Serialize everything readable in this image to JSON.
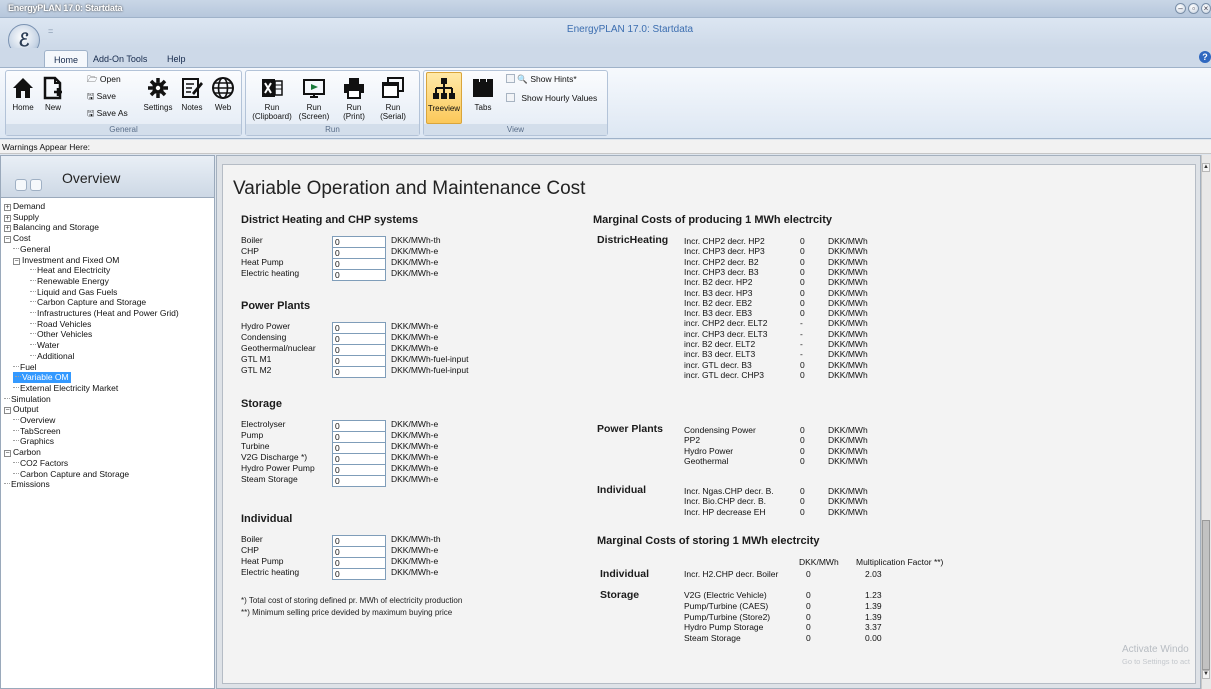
{
  "window": {
    "app_title": "EnergyPLAN 17.0: Startdata",
    "title": "EnergyPLAN 17.0: Startdata",
    "qat_arrow": "=",
    "controls": {
      "minimize": "–",
      "restore": "▫",
      "close": "×"
    }
  },
  "ribbon": {
    "tabs": [
      "Home",
      "Add-On Tools",
      "Help"
    ],
    "general": {
      "caption": "General",
      "home": "Home",
      "new": "New",
      "open": "Open",
      "save": "Save",
      "save_as": "Save As",
      "settings": "Settings",
      "notes": "Notes",
      "web": "Web"
    },
    "run": {
      "caption": "Run",
      "clipboard": [
        "Run",
        "(Clipboard)"
      ],
      "screen": [
        "Run",
        "(Screen)"
      ],
      "print": [
        "Run",
        "(Print)"
      ],
      "serial": [
        "Run",
        "(Serial)"
      ]
    },
    "view": {
      "caption": "View",
      "treeview": "Treeview",
      "tabs": "Tabs",
      "show_hints": "Show Hints*",
      "show_hourly": "Show Hourly Values"
    }
  },
  "warnings": "Warnings Appear Here:",
  "overview": {
    "title": "Overview",
    "tree": [
      {
        "label": "Demand",
        "level": 0,
        "exp": "+"
      },
      {
        "label": "Supply",
        "level": 0,
        "exp": "+"
      },
      {
        "label": "Balancing and Storage",
        "level": 0,
        "exp": "+"
      },
      {
        "label": "Cost",
        "level": 0,
        "exp": "-"
      },
      {
        "label": "General",
        "level": 1
      },
      {
        "label": "Investment and Fixed OM",
        "level": 1,
        "exp": "-"
      },
      {
        "label": "Heat and Electricity",
        "level": 2
      },
      {
        "label": "Renewable Energy",
        "level": 2
      },
      {
        "label": "Liquid and Gas Fuels",
        "level": 2
      },
      {
        "label": "Carbon Capture and Storage",
        "level": 2
      },
      {
        "label": "Infrastructures (Heat and Power Grid)",
        "level": 2
      },
      {
        "label": "Road Vehicles",
        "level": 2
      },
      {
        "label": "Other Vehicles",
        "level": 2
      },
      {
        "label": "Water",
        "level": 2
      },
      {
        "label": "Additional",
        "level": 2
      },
      {
        "label": "Fuel",
        "level": 1
      },
      {
        "label": "Variable OM",
        "level": 1,
        "selected": true
      },
      {
        "label": "External Electricity Market",
        "level": 1
      },
      {
        "label": "Simulation",
        "level": 0
      },
      {
        "label": "Output",
        "level": 0,
        "exp": "-"
      },
      {
        "label": "Overview",
        "level": 1
      },
      {
        "label": "TabScreen",
        "level": 1
      },
      {
        "label": "Graphics",
        "level": 1
      },
      {
        "label": "Carbon",
        "level": 0,
        "exp": "-"
      },
      {
        "label": "CO2 Factors",
        "level": 1
      },
      {
        "label": "Carbon Capture and Storage",
        "level": 1
      },
      {
        "label": "Emissions",
        "level": 0
      }
    ]
  },
  "main": {
    "title": "Variable Operation and Maintenance Cost",
    "dh": {
      "heading": "District Heating and CHP systems",
      "rows": [
        {
          "label": "Boiler",
          "value": "0",
          "unit": "DKK/MWh-th"
        },
        {
          "label": "CHP",
          "value": "0",
          "unit": "DKK/MWh-e"
        },
        {
          "label": "Heat Pump",
          "value": "0",
          "unit": "DKK/MWh-e"
        },
        {
          "label": "Electric heating",
          "value": "0",
          "unit": "DKK/MWh-e"
        }
      ]
    },
    "pp": {
      "heading": "Power Plants",
      "rows": [
        {
          "label": "Hydro Power",
          "value": "0",
          "unit": "DKK/MWh-e"
        },
        {
          "label": "Condensing",
          "value": "0",
          "unit": "DKK/MWh-e"
        },
        {
          "label": "Geothermal/nuclear",
          "value": "0",
          "unit": "DKK/MWh-e"
        },
        {
          "label": "GTL M1",
          "value": "0",
          "unit": "DKK/MWh-fuel-input"
        },
        {
          "label": "GTL M2",
          "value": "0",
          "unit": "DKK/MWh-fuel-input"
        }
      ]
    },
    "st": {
      "heading": "Storage",
      "rows": [
        {
          "label": "Electrolyser",
          "value": "0",
          "unit": "DKK/MWh-e"
        },
        {
          "label": "Pump",
          "value": "0",
          "unit": "DKK/MWh-e"
        },
        {
          "label": "Turbine",
          "value": "0",
          "unit": "DKK/MWh-e"
        },
        {
          "label": "V2G Discharge *)",
          "value": "0",
          "unit": "DKK/MWh-e"
        },
        {
          "label": "Hydro Power Pump",
          "value": "0",
          "unit": "DKK/MWh-e"
        },
        {
          "label": "Steam Storage",
          "value": "0",
          "unit": "DKK/MWh-e"
        }
      ]
    },
    "ind": {
      "heading": "Individual",
      "rows": [
        {
          "label": "Boiler",
          "value": "0",
          "unit": "DKK/MWh-th"
        },
        {
          "label": "CHP",
          "value": "0",
          "unit": "DKK/MWh-e"
        },
        {
          "label": "Heat Pump",
          "value": "0",
          "unit": "DKK/MWh-e"
        },
        {
          "label": "Electric heating",
          "value": "0",
          "unit": "DKK/MWh-e"
        }
      ]
    },
    "notes": [
      "*) Total cost of storing defined pr. MWh of electricity production",
      "**) Minimum selling price devided by maximum buying price"
    ],
    "marginal_produce": {
      "heading": "Marginal Costs of producing 1 MWh electrcity",
      "sections": [
        {
          "title": "DistricHeating",
          "rows": [
            [
              "Incr. CHP2 decr. HP2",
              "0",
              "DKK/MWh"
            ],
            [
              "Incr. CHP3 decr. HP3",
              "0",
              "DKK/MWh"
            ],
            [
              "Incr. CHP2 decr. B2",
              "0",
              "DKK/MWh"
            ],
            [
              "Incr. CHP3 decr. B3",
              "0",
              "DKK/MWh"
            ],
            [
              "Incr. B2 decr. HP2",
              "0",
              "DKK/MWh"
            ],
            [
              "Incr. B3 decr. HP3",
              "0",
              "DKK/MWh"
            ],
            [
              "Incr. B2 decr. EB2",
              "0",
              "DKK/MWh"
            ],
            [
              "Incr. B3 decr. EB3",
              "0",
              "DKK/MWh"
            ],
            [
              "incr. CHP2 decr. ELT2",
              "-",
              "DKK/MWh"
            ],
            [
              "incr. CHP3 decr. ELT3",
              "-",
              "DKK/MWh"
            ],
            [
              "incr. B2 decr. ELT2",
              "-",
              "DKK/MWh"
            ],
            [
              "incr. B3 decr. ELT3",
              "-",
              "DKK/MWh"
            ],
            [
              "incr. GTL decr. B3",
              "0",
              "DKK/MWh"
            ],
            [
              "incr. GTL decr. CHP3",
              "0",
              "DKK/MWh"
            ]
          ]
        },
        {
          "title": "Power Plants",
          "rows": [
            [
              "Condensing Power",
              "0",
              "DKK/MWh"
            ],
            [
              "PP2",
              "0",
              "DKK/MWh"
            ],
            [
              "Hydro Power",
              "0",
              "DKK/MWh"
            ],
            [
              "Geothermal",
              "0",
              "DKK/MWh"
            ]
          ]
        },
        {
          "title": "Individual",
          "rows": [
            [
              "Incr. Ngas.CHP decr. B.",
              "0",
              "DKK/MWh"
            ],
            [
              "Incr. Bio.CHP decr. B.",
              "0",
              "DKK/MWh"
            ],
            [
              "Incr. HP decrease EH",
              "0",
              "DKK/MWh"
            ]
          ]
        }
      ]
    },
    "marginal_store": {
      "heading": "Marginal Costs of storing 1 MWh electrcity",
      "col1": "DKK/MWh",
      "col2": "Multiplication Factor **)",
      "sections": [
        {
          "title": "Individual",
          "rows": [
            [
              "Incr. H2.CHP decr. Boiler",
              "0",
              "2.03"
            ]
          ]
        },
        {
          "title": "Storage",
          "rows": [
            [
              "V2G (Electric Vehicle)",
              "0",
              "1.23"
            ],
            [
              "Pump/Turbine (CAES)",
              "0",
              "1.39"
            ],
            [
              "Pump/Turbine (Store2)",
              "0",
              "1.39"
            ],
            [
              "Hydro Pump Storage",
              "0",
              "3.37"
            ],
            [
              "Steam Storage",
              "0",
              "0.00"
            ]
          ]
        }
      ]
    }
  },
  "watermark": {
    "line1": "Activate Windo",
    "line2": "Go to Settings to act"
  }
}
